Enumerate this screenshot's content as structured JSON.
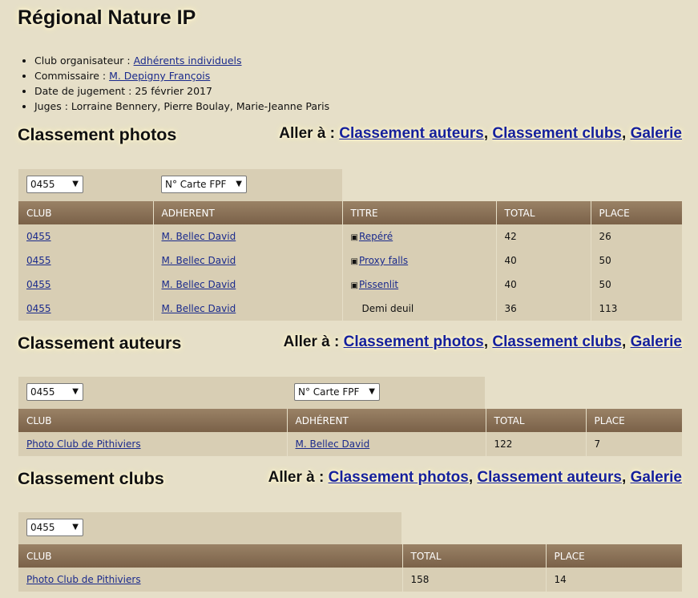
{
  "page_title": "Régional Nature IP",
  "info": {
    "organizer_label": "Club organisateur : ",
    "organizer_value": "Adhérents individuels",
    "commissioner_label": "Commissaire : ",
    "commissioner_value": "M. Depigny François",
    "date_label": "Date de jugement : ",
    "date_value": "25 février 2017",
    "judges_label": "Juges : ",
    "judges_value": "Lorraine Bennery, Pierre Boulay, Marie-Jeanne Paris"
  },
  "goto_label": "Aller à :",
  "links": {
    "photos": "Classement photos",
    "auteurs": "Classement auteurs",
    "clubs": "Classement clubs",
    "galerie": "Galerie"
  },
  "sep": ",",
  "filters": {
    "club_value": "0455",
    "card_value": "N° Carte FPF"
  },
  "icons": {
    "dropdown": "chevron-down-icon",
    "photo": "photo-icon"
  },
  "colors": {
    "background": "#e6dfc8",
    "header": "#8a7156",
    "link": "#1a2a8c"
  },
  "photos": {
    "title": "Classement photos",
    "headers": [
      "CLUB",
      "ADHERENT",
      "TITRE",
      "TOTAL",
      "PLACE"
    ],
    "rows": [
      {
        "club": "0455",
        "adherent": "M. Bellec David",
        "titre": "Repéré",
        "total": "42",
        "place": "26"
      },
      {
        "club": "0455",
        "adherent": "M. Bellec David",
        "titre": "Proxy falls",
        "total": "40",
        "place": "50"
      },
      {
        "club": "0455",
        "adherent": "M. Bellec David",
        "titre": "Pissenlit",
        "total": "40",
        "place": "50"
      },
      {
        "club": "0455",
        "adherent": "M. Bellec David",
        "titre": "Demi deuil",
        "total": "36",
        "place": "113"
      }
    ]
  },
  "auteurs": {
    "title": "Classement auteurs",
    "headers": [
      "CLUB",
      "ADHÉRENT",
      "TOTAL",
      "PLACE"
    ],
    "rows": [
      {
        "club": "Photo Club de Pithiviers",
        "adherent": "M. Bellec David",
        "total": "122",
        "place": "7"
      }
    ]
  },
  "clubs": {
    "title": "Classement clubs",
    "headers": [
      "CLUB",
      "TOTAL",
      "PLACE"
    ],
    "rows": [
      {
        "club": "Photo Club de Pithiviers",
        "total": "158",
        "place": "14"
      }
    ]
  }
}
